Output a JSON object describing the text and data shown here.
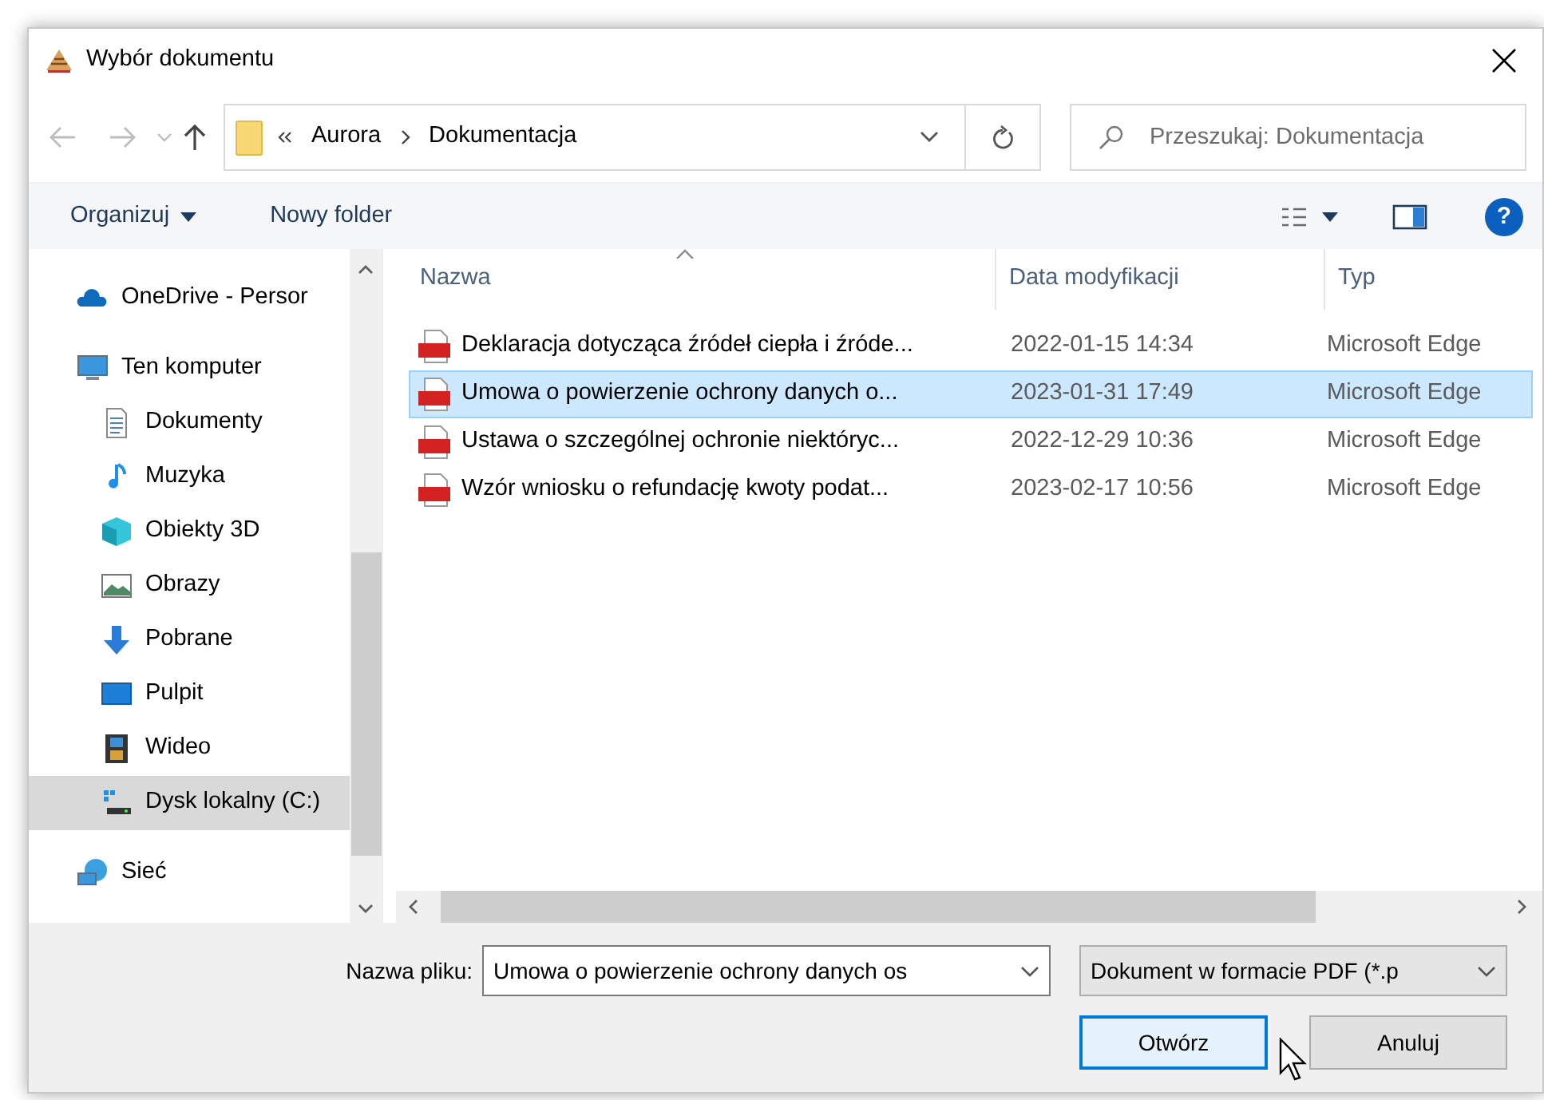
{
  "window": {
    "title": "Wybór dokumentu"
  },
  "nav": {
    "breadcrumb": [
      "Aurora",
      "Dokumentacja"
    ],
    "search": {
      "placeholder": "Przeszukaj: Dokumentacja"
    }
  },
  "toolbar": {
    "buttons": [
      "Organizuj",
      "Nowy folder"
    ],
    "help": "?"
  },
  "sidebar": {
    "items": [
      {
        "label": "OneDrive - Persor",
        "selected": false
      },
      {
        "label": "Ten komputer",
        "selected": false,
        "children": [
          {
            "label": "Dokumenty",
            "selected": false
          },
          {
            "label": "Muzyka",
            "selected": false
          },
          {
            "label": "Obiekty 3D",
            "selected": false
          },
          {
            "label": "Obrazy",
            "selected": false
          },
          {
            "label": "Pobrane",
            "selected": false
          },
          {
            "label": "Pulpit",
            "selected": false
          },
          {
            "label": "Wideo",
            "selected": false
          },
          {
            "label": "Dysk lokalny (C:)",
            "selected": true
          }
        ]
      },
      {
        "label": "Sieć",
        "selected": false
      }
    ]
  },
  "table": {
    "columns": [
      "Nazwa",
      "Data modyfikacji",
      "Typ"
    ],
    "rows": [
      {
        "name": "Deklaracja dotycząca źródeł ciepła i źróde...",
        "modified": "2022-01-15 14:34",
        "type": "Microsoft Edge",
        "selected": false
      },
      {
        "name": "Umowa o powierzenie ochrony danych o...",
        "modified": "2023-01-31 17:49",
        "type": "Microsoft Edge",
        "selected": true
      },
      {
        "name": "Ustawa o szczególnej ochronie niektóryc...",
        "modified": "2022-12-29 10:36",
        "type": "Microsoft Edge",
        "selected": false
      },
      {
        "name": "Wzór wniosku o refundację kwoty podat...",
        "modified": "2023-02-17 10:56",
        "type": "Microsoft Edge",
        "selected": false
      }
    ]
  },
  "footer": {
    "filename_label": "Nazwa pliku:",
    "filename": "Umowa o powierzenie ochrony danych os",
    "filter": "Dokument w formacie PDF (*.p",
    "buttons": [
      "Otwórz",
      "Anuluj"
    ]
  }
}
